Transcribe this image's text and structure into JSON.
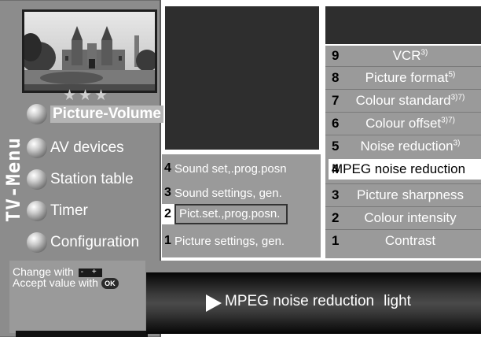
{
  "side_menu": {
    "vertical_title": "TV-Menu",
    "rating_stars": "★★★",
    "items": [
      {
        "label": "Picture-Volume",
        "selected": true
      },
      {
        "label": "AV devices",
        "selected": false
      },
      {
        "label": "Station table",
        "selected": false
      },
      {
        "label": "Timer",
        "selected": false
      },
      {
        "label": "Configuration",
        "selected": false
      }
    ]
  },
  "help": {
    "change_with": "Change with",
    "change_key": "- +",
    "accept_with": "Accept value with",
    "accept_key": "OK"
  },
  "submenu": {
    "items": [
      {
        "num": "4",
        "label": "Sound set,.prog.posn",
        "selected": false
      },
      {
        "num": "3",
        "label": "Sound settings, gen.",
        "selected": false
      },
      {
        "num": "2",
        "label": "Pict.set.,prog.posn.",
        "selected": true
      },
      {
        "num": "1",
        "label": "Picture settings, gen.",
        "selected": false
      }
    ]
  },
  "options": {
    "items": [
      {
        "num": "9",
        "label": "VCR",
        "sup": "3)",
        "selected": false
      },
      {
        "num": "8",
        "label": "Picture format",
        "sup": "5)",
        "selected": false
      },
      {
        "num": "7",
        "label": "Colour  standard",
        "sup": "3)7)",
        "selected": false
      },
      {
        "num": "6",
        "label": "Colour offset",
        "sup": "3)7)",
        "selected": false
      },
      {
        "num": "5",
        "label": "Noise reduction",
        "sup": "3)",
        "selected": false
      },
      {
        "num": "4",
        "label": "MPEG noise reduction",
        "sup": "",
        "selected": true
      },
      {
        "num": "3",
        "label": "Picture sharpness",
        "sup": "",
        "selected": false
      },
      {
        "num": "2",
        "label": "Colour intensity",
        "sup": "",
        "selected": false
      },
      {
        "num": "1",
        "label": "Contrast",
        "sup": "",
        "selected": false
      }
    ]
  },
  "status_bar": {
    "setting": "MPEG noise reduction",
    "value": "light"
  },
  "colors": {
    "panel_gray": "#9a9a9a",
    "dark_panel": "#2e2e2e",
    "text": "#ffffff"
  },
  "icons": [
    "play-arrow-icon",
    "menu-ball-icon",
    "minus-plus-key-icon",
    "ok-key-icon"
  ]
}
